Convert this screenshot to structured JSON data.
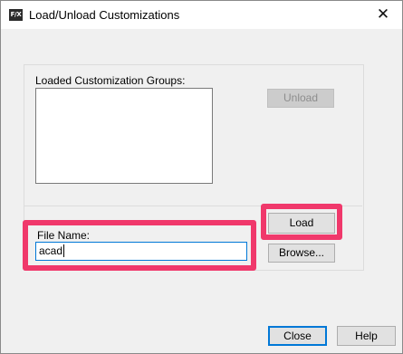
{
  "window": {
    "title": "Load/Unload Customizations",
    "app_icon_text": "F/X",
    "close_glyph": "✕"
  },
  "groups": {
    "label": "Loaded Customization Groups:",
    "items": []
  },
  "buttons": {
    "unload": "Unload",
    "load": "Load",
    "browse": "Browse...",
    "close": "Close",
    "help": "Help"
  },
  "file": {
    "label": "File Name:",
    "value": "acad"
  },
  "colors": {
    "highlight": "#f0386b",
    "focus": "#0078d7"
  }
}
